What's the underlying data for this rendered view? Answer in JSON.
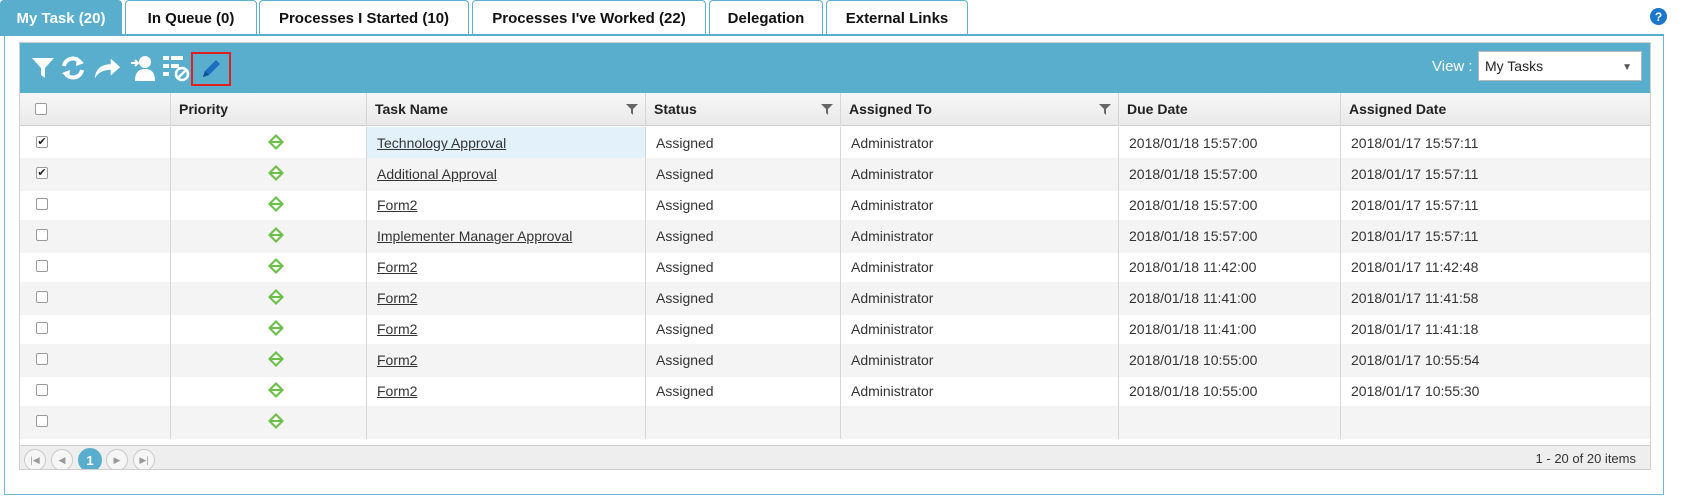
{
  "tabs": [
    {
      "label": "My Task (20)",
      "active": true
    },
    {
      "label": "In Queue (0)",
      "active": false
    },
    {
      "label": "Processes I Started (10)",
      "active": false
    },
    {
      "label": "Processes I've Worked (22)",
      "active": false
    },
    {
      "label": "Delegation",
      "active": false
    },
    {
      "label": "External Links",
      "active": false
    }
  ],
  "help": {
    "icon": "help-icon",
    "glyph": "?"
  },
  "toolbar": {
    "icons": [
      "filter-icon",
      "refresh-icon",
      "forward-icon",
      "reassign-user-icon",
      "clear-filter-icon",
      "edit-pencil-icon"
    ],
    "view_label": "View :",
    "view_value": "My Tasks"
  },
  "colors": {
    "accent": "#5aaecd",
    "priority": "#6cc04a",
    "highlight_border": "#e02020"
  },
  "columns": [
    "Priority",
    "Task Name",
    "Status",
    "Assigned To",
    "Due Date",
    "Assigned Date"
  ],
  "rows": [
    {
      "checked": true,
      "task": "Technology Approval",
      "status": "Assigned",
      "assigned_to": "Administrator",
      "due": "2018/01/18 15:57:00",
      "assigned": "2018/01/17 15:57:11"
    },
    {
      "checked": true,
      "task": "Additional Approval",
      "status": "Assigned",
      "assigned_to": "Administrator",
      "due": "2018/01/18 15:57:00",
      "assigned": "2018/01/17 15:57:11"
    },
    {
      "checked": false,
      "task": "Form2",
      "status": "Assigned",
      "assigned_to": "Administrator",
      "due": "2018/01/18 15:57:00",
      "assigned": "2018/01/17 15:57:11"
    },
    {
      "checked": false,
      "task": "Implementer Manager Approval",
      "status": "Assigned",
      "assigned_to": "Administrator",
      "due": "2018/01/18 15:57:00",
      "assigned": "2018/01/17 15:57:11"
    },
    {
      "checked": false,
      "task": "Form2",
      "status": "Assigned",
      "assigned_to": "Administrator",
      "due": "2018/01/18 11:42:00",
      "assigned": "2018/01/17 11:42:48"
    },
    {
      "checked": false,
      "task": "Form2",
      "status": "Assigned",
      "assigned_to": "Administrator",
      "due": "2018/01/18 11:41:00",
      "assigned": "2018/01/17 11:41:58"
    },
    {
      "checked": false,
      "task": "Form2",
      "status": "Assigned",
      "assigned_to": "Administrator",
      "due": "2018/01/18 11:41:00",
      "assigned": "2018/01/17 11:41:18"
    },
    {
      "checked": false,
      "task": "Form2",
      "status": "Assigned",
      "assigned_to": "Administrator",
      "due": "2018/01/18 10:55:00",
      "assigned": "2018/01/17 10:55:54"
    },
    {
      "checked": false,
      "task": "Form2",
      "status": "Assigned",
      "assigned_to": "Administrator",
      "due": "2018/01/18 10:55:00",
      "assigned": "2018/01/17 10:55:30"
    },
    {
      "checked": false,
      "task": "",
      "status": "",
      "assigned_to": "",
      "due": "",
      "assigned": ""
    }
  ],
  "pager": {
    "current_page": "1",
    "info": "1 - 20 of 20 items",
    "buttons": [
      "first-page-icon",
      "prev-page-icon",
      "next-page-icon",
      "last-page-icon"
    ]
  }
}
